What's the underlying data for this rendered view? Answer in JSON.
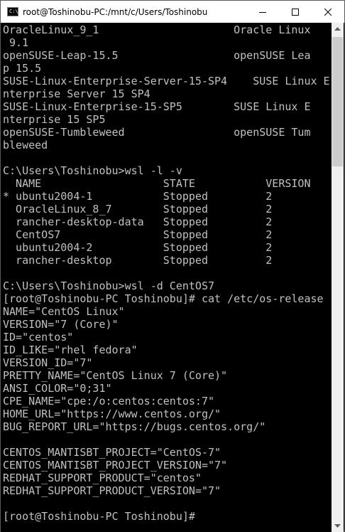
{
  "window": {
    "title": "root@Toshinobu-PC:/mnt/c/Users/Toshinobu",
    "icon_label": "C:\\",
    "controls": [
      "minimize-icon",
      "maximize-icon",
      "close-icon"
    ]
  },
  "terminal": {
    "lines": [
      "OracleLinux_9_1                     Oracle Linux",
      " 9.1",
      "openSUSE-Leap-15.5                  openSUSE Lea",
      "p 15.5",
      "SUSE-Linux-Enterprise-Server-15-SP4    SUSE Linux E",
      "nterprise Server 15 SP4",
      "SUSE-Linux-Enterprise-15-SP5        SUSE Linux E",
      "nterprise 15 SP5",
      "openSUSE-Tumbleweed                 openSUSE Tum",
      "bleweed",
      "",
      "C:\\Users\\Toshinobu>wsl -l -v",
      "  NAME                   STATE           VERSION",
      "* ubuntu2004-1           Stopped         2",
      "  OracleLinux_8_7        Stopped         2",
      "  rancher-desktop-data   Stopped         2",
      "  CentOS7                Stopped         2",
      "  ubuntu2004-2           Stopped         2",
      "  rancher-desktop        Stopped         2",
      "",
      "C:\\Users\\Toshinobu>wsl -d CentOS7",
      "[root@Toshinobu-PC Toshinobu]# cat /etc/os-release",
      "NAME=\"CentOS Linux\"",
      "VERSION=\"7 (Core)\"",
      "ID=\"centos\"",
      "ID_LIKE=\"rhel fedora\"",
      "VERSION_ID=\"7\"",
      "PRETTY_NAME=\"CentOS Linux 7 (Core)\"",
      "ANSI_COLOR=\"0;31\"",
      "CPE_NAME=\"cpe:/o:centos:centos:7\"",
      "HOME_URL=\"https://www.centos.org/\"",
      "BUG_REPORT_URL=\"https://bugs.centos.org/\"",
      "",
      "CENTOS_MANTISBT_PROJECT=\"CentOS-7\"",
      "CENTOS_MANTISBT_PROJECT_VERSION=\"7\"",
      "REDHAT_SUPPORT_PRODUCT=\"centos\"",
      "REDHAT_SUPPORT_PRODUCT_VERSION=\"7\"",
      "",
      "[root@Toshinobu-PC Toshinobu]#"
    ]
  },
  "colors": {
    "terminal_bg": "#000000",
    "terminal_fg": "#c0c0c0",
    "titlebar_bg": "#ffffff"
  }
}
